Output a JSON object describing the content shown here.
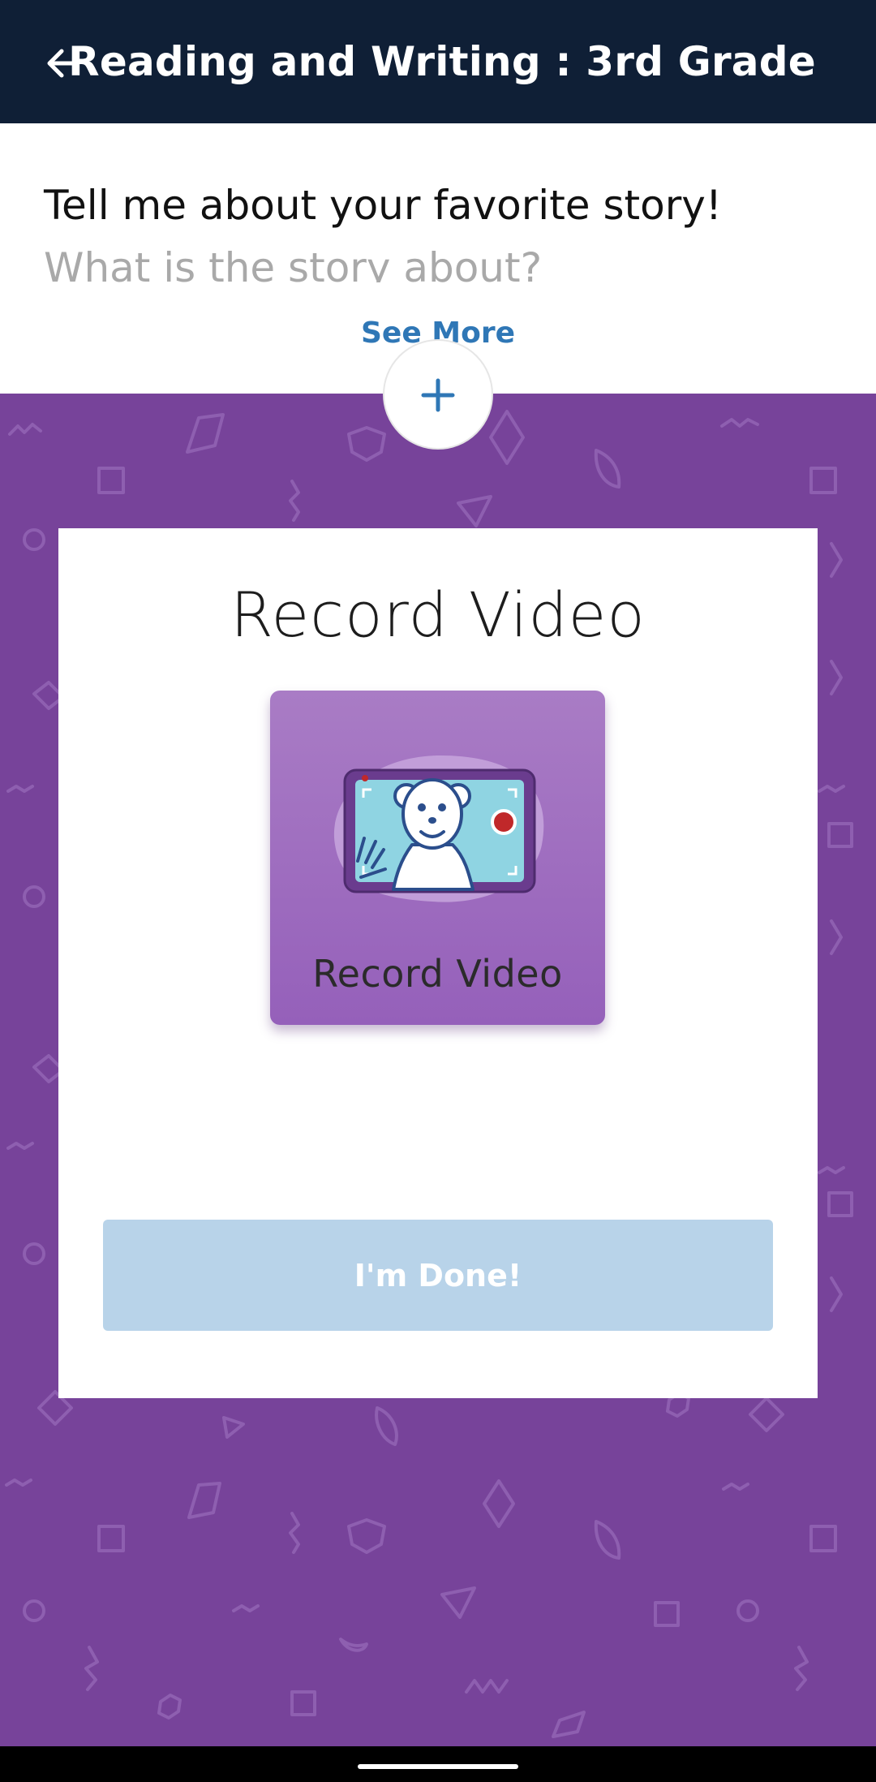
{
  "header": {
    "title": "Reading and Writing : 3rd Grade",
    "back_icon": "arrow-left-icon"
  },
  "prompt": {
    "line1": "Tell me about your favorite story!",
    "line2": "What is the story about?",
    "see_more": "See More"
  },
  "add_button": {
    "icon": "plus-icon"
  },
  "card": {
    "title": "Record Video",
    "tile_label": "Record Video",
    "done_label": "I'm Done!"
  },
  "colors": {
    "header_bg": "#0f1f36",
    "link": "#2f77b6",
    "purple_bg": "#77439a",
    "tile_purple": "#9560ba",
    "done_disabled": "#b8d3e9"
  }
}
